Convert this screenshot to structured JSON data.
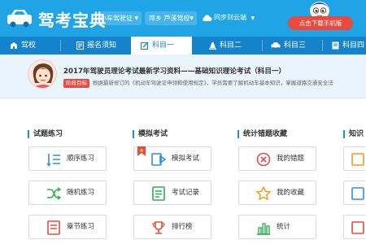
{
  "header": {
    "app_title": "驾考宝典",
    "car_select": "小车驾驶证",
    "region_select": "萍乡 芦溪驾校",
    "sync_label": "同步到云端",
    "mobile_button": "点击下载手机版"
  },
  "nav": {
    "tabs": [
      {
        "label": "驾校",
        "icon": "school-icon"
      },
      {
        "label": "报名须知",
        "icon": "document-icon"
      },
      {
        "label": "科目一",
        "icon": "edit-icon",
        "active": true
      },
      {
        "label": "科目二",
        "icon": "cone-icon"
      },
      {
        "label": "科目三",
        "icon": "car-icon"
      },
      {
        "label": "科目四",
        "icon": "file-icon"
      }
    ]
  },
  "banner": {
    "title": "2017年驾驶员理论考试最新学习资料——基础知识理论考试（科目一）",
    "badge": "阶段目标",
    "description": "根据最新修订的《机动车驾驶证申领和使用规定》，学员需要了解机动车基本知识，掌握道路交通安全法"
  },
  "columns": [
    {
      "heading": "试题练习",
      "items": [
        {
          "label": "顺序练习",
          "icon": "list-icon"
        },
        {
          "label": "随机练习",
          "icon": "shuffle-icon"
        },
        {
          "label": "章节练习",
          "icon": "chapter-icon"
        }
      ]
    },
    {
      "heading": "模拟考试",
      "items": [
        {
          "label": "模拟考试",
          "icon": "play-exam-icon"
        },
        {
          "label": "考试记录",
          "icon": "record-icon"
        },
        {
          "label": "排行榜",
          "icon": "trophy-icon"
        }
      ]
    },
    {
      "heading": "统计错题收藏",
      "items": [
        {
          "label": "我的错题",
          "icon": "wrong-icon"
        },
        {
          "label": "我的收藏",
          "icon": "star-icon"
        },
        {
          "label": "统计",
          "icon": "stats-icon"
        }
      ]
    },
    {
      "heading": "知识",
      "items": [
        {},
        {},
        {}
      ]
    }
  ],
  "colors": {
    "primary": "#1fa5e5",
    "nav": "#1583cc",
    "accent_red": "#e94a3f",
    "icon_blue": "#2b8fe0",
    "icon_green": "#2fae4e",
    "icon_orange": "#f29b1f"
  }
}
